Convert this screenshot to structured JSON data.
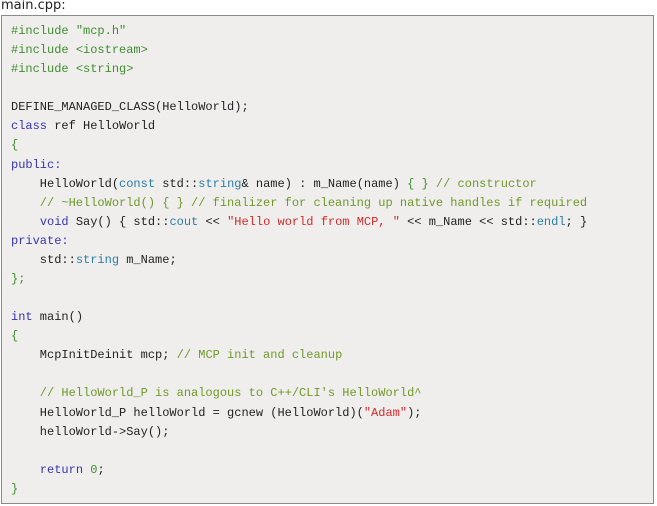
{
  "file_label": "main.cpp:",
  "code": {
    "lines": [
      [
        {
          "t": "pre",
          "v": "#include "
        },
        {
          "t": "inc",
          "v": "\"mcp.h\""
        }
      ],
      [
        {
          "t": "pre",
          "v": "#include "
        },
        {
          "t": "inc",
          "v": "<iostream>"
        }
      ],
      [
        {
          "t": "pre",
          "v": "#include "
        },
        {
          "t": "inc",
          "v": "<string>"
        }
      ],
      [],
      [
        {
          "t": "plain",
          "v": "DEFINE_MANAGED_CLASS(HelloWorld);"
        }
      ],
      [
        {
          "t": "kw",
          "v": "class"
        },
        {
          "t": "plain",
          "v": " ref HelloWorld"
        }
      ],
      [
        {
          "t": "brace",
          "v": "{"
        }
      ],
      [
        {
          "t": "kw",
          "v": "public:"
        }
      ],
      [
        {
          "t": "plain",
          "v": "    HelloWorld("
        },
        {
          "t": "type",
          "v": "const"
        },
        {
          "t": "plain",
          "v": " std::"
        },
        {
          "t": "type",
          "v": "string"
        },
        {
          "t": "plain",
          "v": "& name) : m_Name(name) "
        },
        {
          "t": "brace",
          "v": "{ }"
        },
        {
          "t": "com",
          "v": " // constructor"
        }
      ],
      [
        {
          "t": "com",
          "v": "    // ~HelloWorld() { } // finalizer for cleaning up native handles if required"
        }
      ],
      [
        {
          "t": "plain",
          "v": "    "
        },
        {
          "t": "kw",
          "v": "void"
        },
        {
          "t": "plain",
          "v": " Say() { std::"
        },
        {
          "t": "type",
          "v": "cout"
        },
        {
          "t": "plain",
          "v": " << "
        },
        {
          "t": "str",
          "v": "\"Hello world from MCP, \""
        },
        {
          "t": "plain",
          "v": " << m_Name << std::"
        },
        {
          "t": "type",
          "v": "endl"
        },
        {
          "t": "plain",
          "v": "; }"
        }
      ],
      [
        {
          "t": "kw",
          "v": "private:"
        }
      ],
      [
        {
          "t": "plain",
          "v": "    std::"
        },
        {
          "t": "type",
          "v": "string"
        },
        {
          "t": "plain",
          "v": " m_Name;"
        }
      ],
      [
        {
          "t": "brace",
          "v": "};"
        }
      ],
      [],
      [
        {
          "t": "kw",
          "v": "int"
        },
        {
          "t": "plain",
          "v": " main()"
        }
      ],
      [
        {
          "t": "brace",
          "v": "{"
        }
      ],
      [
        {
          "t": "plain",
          "v": "    McpInitDeinit mcp; "
        },
        {
          "t": "com",
          "v": "// MCP init and cleanup"
        }
      ],
      [],
      [
        {
          "t": "com",
          "v": "    // HelloWorld_P is analogous to C++/CLI's HelloWorld^"
        }
      ],
      [
        {
          "t": "plain",
          "v": "    HelloWorld_P helloWorld = gcnew (HelloWorld)("
        },
        {
          "t": "str",
          "v": "\"Adam\""
        },
        {
          "t": "plain",
          "v": ");"
        }
      ],
      [
        {
          "t": "plain",
          "v": "    helloWorld->Say();"
        }
      ],
      [],
      [
        {
          "t": "plain",
          "v": "    "
        },
        {
          "t": "kw",
          "v": "return"
        },
        {
          "t": "plain",
          "v": " "
        },
        {
          "t": "num",
          "v": "0"
        },
        {
          "t": "plain",
          "v": ";"
        }
      ],
      [
        {
          "t": "brace",
          "v": "}"
        }
      ]
    ]
  }
}
